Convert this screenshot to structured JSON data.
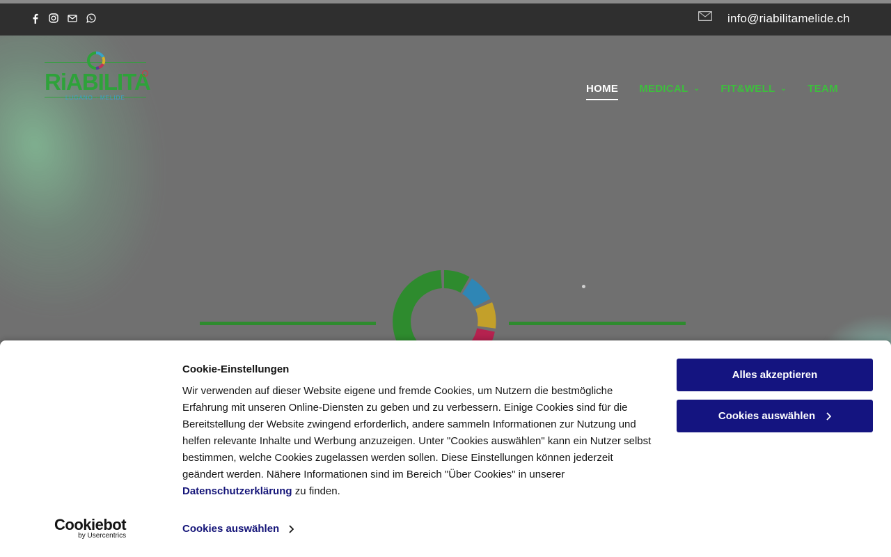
{
  "topbar": {
    "social_icons": [
      "facebook-icon",
      "instagram-icon",
      "mail-icon",
      "whatsapp-icon"
    ],
    "email": "info@riabilitamelide.ch"
  },
  "logo": {
    "text": "RiABILITA",
    "sub": "LUGANO · MELIDE"
  },
  "nav": {
    "items": [
      {
        "label": "HOME",
        "active": true,
        "has_dropdown": false
      },
      {
        "label": "MEDICAL",
        "active": false,
        "has_dropdown": true
      },
      {
        "label": "FIT&WELL",
        "active": false,
        "has_dropdown": true
      },
      {
        "label": "TEAM",
        "active": false,
        "has_dropdown": false
      }
    ]
  },
  "cookie": {
    "title": "Cookie-Einstellungen",
    "text_before_link": "Wir verwenden auf dieser Website eigene und fremde Cookies, um Nutzern die bestmögliche Erfahrung mit unseren Online-Diensten zu geben und zu verbessern. Einige Cookies sind für die Bereitstellung der Website zwingend erforderlich, andere sammeln Informationen zur Nutzung und helfen relevante Inhalte und Werbung anzuzeigen. Unter \"Cookies auswählen\" kann ein Nutzer selbst bestimmen, welche Cookies zugelassen werden sollen. Diese Einstellungen können jederzeit geändert werden. Nähere Informationen sind im Bereich \"Über Cookies\" in unserer ",
    "link_text": "Datenschutzerklärung",
    "text_after_link": " zu finden.",
    "accept_all_label": "Alles akzeptieren",
    "choose_label": "Cookies auswählen",
    "select_link_label": "Cookies auswählen",
    "brand_main": "Cookiebot",
    "brand_sub": "by Usercentrics"
  },
  "colors": {
    "topbar_bg": "#2f2f2f",
    "nav_green": "#3dbf3d",
    "button_navy": "#141480"
  }
}
